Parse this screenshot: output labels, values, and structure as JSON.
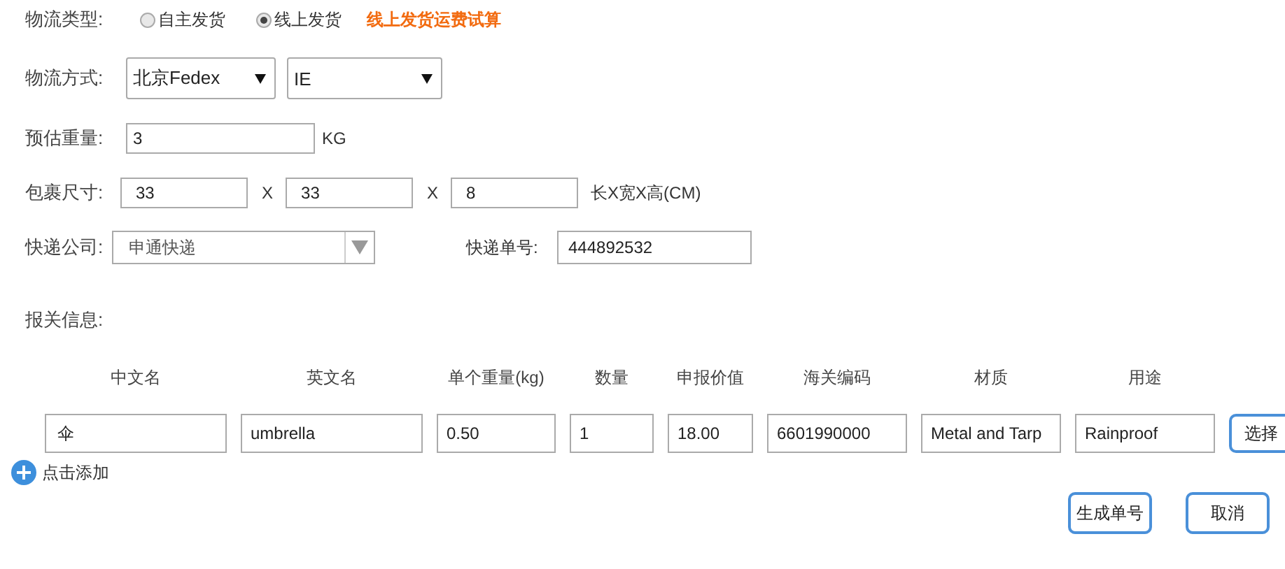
{
  "logistics_type": {
    "label": "物流类型:",
    "options": [
      {
        "label": "自主发货",
        "selected": false
      },
      {
        "label": "线上发货",
        "selected": true
      }
    ],
    "link": "线上发货运费试算"
  },
  "logistics_method": {
    "label": "物流方式:",
    "selects": [
      "北京Fedex",
      "IE"
    ]
  },
  "estimated_weight": {
    "label": "预估重量:",
    "value": "3",
    "unit": "KG"
  },
  "package_size": {
    "label": "包裹尺寸:",
    "values": [
      "33",
      "33",
      "8"
    ],
    "separators": [
      "X",
      "X"
    ],
    "unit": "长X宽X高(CM)"
  },
  "courier": {
    "label": "快递公司:",
    "value": "申通快递"
  },
  "tracking_number": {
    "label": "快递单号:",
    "value": "444892532"
  },
  "customs": {
    "label": "报关信息:",
    "columns": [
      "中文名",
      "英文名",
      "单个重量(kg)",
      "数量",
      "申报价值",
      "海关编码",
      "材质",
      "用途"
    ],
    "rows": [
      {
        "cells": [
          "伞",
          "umbrella",
          "0.50",
          "1",
          "18.00",
          "6601990000",
          "Metal and Tarp",
          "Rainproof"
        ],
        "action": "选择"
      }
    ],
    "add": "点击添加"
  },
  "buttons": [
    "生成单号",
    "取消"
  ]
}
